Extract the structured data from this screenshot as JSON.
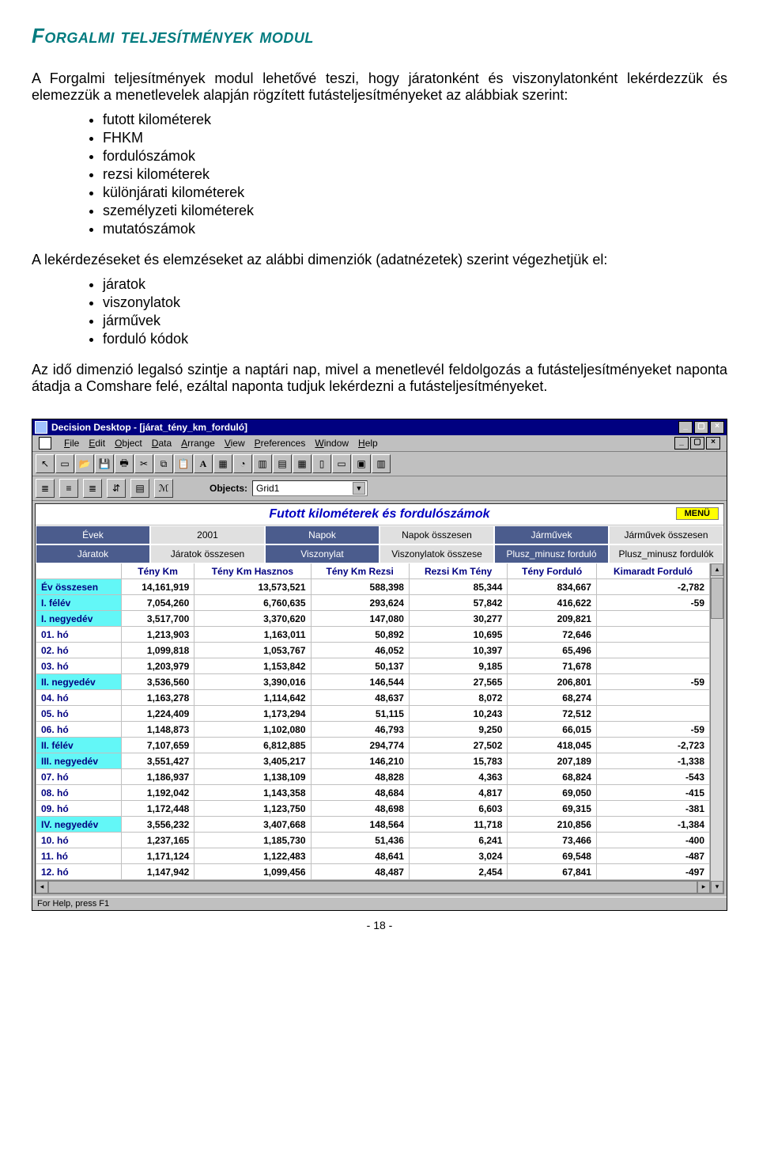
{
  "heading": "Forgalmi teljesítmények modul",
  "para1": "A Forgalmi teljesítmények modul lehetővé teszi, hogy járatonként és viszonylatonként lekérdezzük és elemezzük a menetlevelek alapján rögzített futásteljesítményeket az alábbiak szerint:",
  "list1": [
    "futott kilométerek",
    "FHKM",
    "fordulószámok",
    "rezsi kilométerek",
    "különjárati kilométerek",
    "személyzeti kilométerek",
    "mutatószámok"
  ],
  "para2": "A lekérdezéseket és elemzéseket az alábbi dimenziók (adatnézetek) szerint végezhetjük el:",
  "list2": [
    "járatok",
    "viszonylatok",
    "járművek",
    "forduló kódok"
  ],
  "para3": "Az idő dimenzió legalsó szintje a naptári nap, mivel a menetlevél feldolgozás a futásteljesítményeket naponta átadja a Comshare felé, ezáltal naponta tudjuk lekérdezni a futásteljesítményeket.",
  "pagenum": "- 18 -",
  "app": {
    "title": "Decision Desktop - [járat_tény_km_forduló]",
    "menus": [
      "File",
      "Edit",
      "Object",
      "Data",
      "Arrange",
      "View",
      "Preferences",
      "Window",
      "Help"
    ],
    "objects_label": "Objects:",
    "objects_value": "Grid1",
    "context_title": "Futott kilométerek és fordulószámok",
    "menu_badge": "MENÜ",
    "dims": [
      {
        "head": "Évek",
        "val": "2001"
      },
      {
        "head": "Napok",
        "val": "Napok összesen"
      },
      {
        "head": "Járművek",
        "val": "Járművek összesen"
      }
    ],
    "dims2": [
      {
        "head": "Járatok",
        "val": "Járatok összesen"
      },
      {
        "head": "Viszonylat",
        "val": "Viszonylatok összese"
      },
      {
        "head": "Plusz_minusz forduló",
        "val": "Plusz_minusz fordulók"
      }
    ],
    "status": "For Help, press F1"
  },
  "chart_data": {
    "type": "table",
    "columns": [
      "",
      "Tény Km",
      "Tény Km Hasznos",
      "Tény Km Rezsi",
      "Rezsi Km Tény",
      "Tény Forduló",
      "Kimaradt Forduló"
    ],
    "rows": [
      {
        "label": "Év összesen",
        "cyan": true,
        "cells": [
          "14,161,919",
          "13,573,521",
          "588,398",
          "85,344",
          "834,667",
          "-2,782"
        ]
      },
      {
        "label": "I. félév",
        "cyan": true,
        "cells": [
          "7,054,260",
          "6,760,635",
          "293,624",
          "57,842",
          "416,622",
          "-59"
        ]
      },
      {
        "label": "I. negyedév",
        "cyan": true,
        "cells": [
          "3,517,700",
          "3,370,620",
          "147,080",
          "30,277",
          "209,821",
          ""
        ]
      },
      {
        "label": "01. hó",
        "cyan": false,
        "cells": [
          "1,213,903",
          "1,163,011",
          "50,892",
          "10,695",
          "72,646",
          ""
        ]
      },
      {
        "label": "02. hó",
        "cyan": false,
        "cells": [
          "1,099,818",
          "1,053,767",
          "46,052",
          "10,397",
          "65,496",
          ""
        ]
      },
      {
        "label": "03. hó",
        "cyan": false,
        "cells": [
          "1,203,979",
          "1,153,842",
          "50,137",
          "9,185",
          "71,678",
          ""
        ]
      },
      {
        "label": "II. negyedév",
        "cyan": true,
        "cells": [
          "3,536,560",
          "3,390,016",
          "146,544",
          "27,565",
          "206,801",
          "-59"
        ]
      },
      {
        "label": "04. hó",
        "cyan": false,
        "cells": [
          "1,163,278",
          "1,114,642",
          "48,637",
          "8,072",
          "68,274",
          ""
        ]
      },
      {
        "label": "05. hó",
        "cyan": false,
        "cells": [
          "1,224,409",
          "1,173,294",
          "51,115",
          "10,243",
          "72,512",
          ""
        ]
      },
      {
        "label": "06. hó",
        "cyan": false,
        "cells": [
          "1,148,873",
          "1,102,080",
          "46,793",
          "9,250",
          "66,015",
          "-59"
        ]
      },
      {
        "label": "II. félév",
        "cyan": true,
        "cells": [
          "7,107,659",
          "6,812,885",
          "294,774",
          "27,502",
          "418,045",
          "-2,723"
        ]
      },
      {
        "label": "III. negyedév",
        "cyan": true,
        "cells": [
          "3,551,427",
          "3,405,217",
          "146,210",
          "15,783",
          "207,189",
          "-1,338"
        ]
      },
      {
        "label": "07. hó",
        "cyan": false,
        "cells": [
          "1,186,937",
          "1,138,109",
          "48,828",
          "4,363",
          "68,824",
          "-543"
        ]
      },
      {
        "label": "08. hó",
        "cyan": false,
        "cells": [
          "1,192,042",
          "1,143,358",
          "48,684",
          "4,817",
          "69,050",
          "-415"
        ]
      },
      {
        "label": "09. hó",
        "cyan": false,
        "cells": [
          "1,172,448",
          "1,123,750",
          "48,698",
          "6,603",
          "69,315",
          "-381"
        ]
      },
      {
        "label": "IV. negyedév",
        "cyan": true,
        "cells": [
          "3,556,232",
          "3,407,668",
          "148,564",
          "11,718",
          "210,856",
          "-1,384"
        ]
      },
      {
        "label": "10. hó",
        "cyan": false,
        "cells": [
          "1,237,165",
          "1,185,730",
          "51,436",
          "6,241",
          "73,466",
          "-400"
        ]
      },
      {
        "label": "11. hó",
        "cyan": false,
        "cells": [
          "1,171,124",
          "1,122,483",
          "48,641",
          "3,024",
          "69,548",
          "-487"
        ]
      },
      {
        "label": "12. hó",
        "cyan": false,
        "cells": [
          "1,147,942",
          "1,099,456",
          "48,487",
          "2,454",
          "67,841",
          "-497"
        ]
      }
    ]
  }
}
